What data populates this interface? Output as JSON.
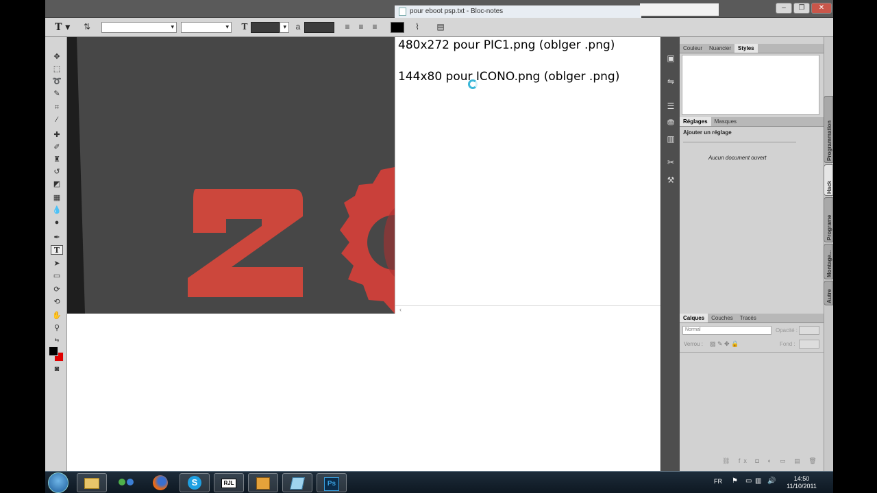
{
  "notepad": {
    "title": "pour eboot psp.txt - Bloc-notes",
    "lines": [
      "480x272 pour PIC1.png  (oblger .png)",
      "144x80 pour ICONO.png (oblger .png)"
    ]
  },
  "options_bar": {
    "tool_glyph": "T",
    "font_family_value": "",
    "font_style_value": "",
    "font_size_glyph": "T",
    "antialias_glyph": "a",
    "text_color": "#000000"
  },
  "tools": {
    "icons": [
      "move-icon",
      "marquee-icon",
      "lasso-icon",
      "quick-selection-icon",
      "crop-icon",
      "eyedropper-icon",
      "spot-healing-icon",
      "brush-icon",
      "clone-stamp-icon",
      "history-brush-icon",
      "eraser-icon",
      "gradient-icon",
      "blur-icon",
      "dodge-icon",
      "pen-icon",
      "type-icon",
      "path-selection-icon",
      "rectangle-icon",
      "3d-rotate-icon",
      "3d-orbit-icon",
      "hand-icon",
      "zoom-icon"
    ],
    "foreground_color": "#000000",
    "background_color": "#e00000"
  },
  "panels": {
    "color_tabs": [
      "Couleur",
      "Nuancier",
      "Styles"
    ],
    "color_tabs_active": "Styles",
    "adjust_tabs": [
      "Réglages",
      "Masques"
    ],
    "adjust_heading": "Ajouter un réglage",
    "adjust_empty": "Aucun document ouvert",
    "layers_tabs": [
      "Calques",
      "Couches",
      "Tracés"
    ],
    "blend_mode": "Normal",
    "opacity_label": "Opacité :",
    "lock_label": "Verrou :",
    "fill_label": "Fond :",
    "side_tabs": [
      "Programmation",
      "Hack",
      "Programe",
      "Montage...",
      "Autre"
    ]
  },
  "taskbar": {
    "apps": [
      "explorer",
      "messenger",
      "firefox",
      "skype",
      "rjl",
      "package",
      "notes",
      "photoshop"
    ],
    "rjl_label": "RJL",
    "ps_label": "Ps",
    "language": "FR",
    "time": "14:50",
    "date": "11/10/2011"
  }
}
